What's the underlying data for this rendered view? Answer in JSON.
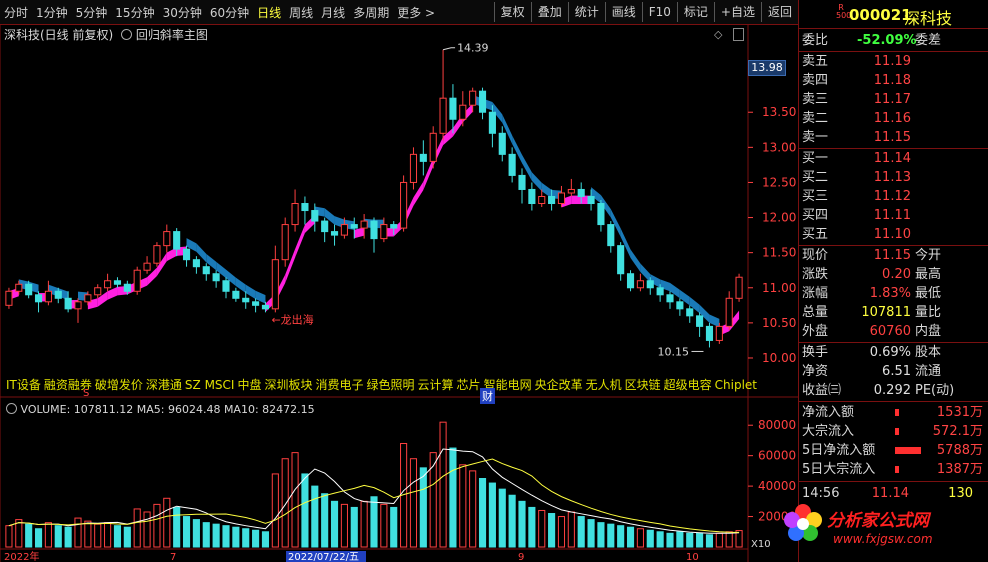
{
  "toolbar": {
    "timeframes": [
      "分时",
      "1分钟",
      "5分钟",
      "15分钟",
      "30分钟",
      "60分钟",
      "日线",
      "周线",
      "月线",
      "多周期",
      "更多 >"
    ],
    "active": "日线",
    "buttons": [
      "复权",
      "叠加",
      "统计",
      "画线",
      "F10",
      "标记",
      "+自选",
      "返回"
    ]
  },
  "chart": {
    "title": "深科技(日线 前复权)",
    "indicator_title": "回归斜率主图",
    "price_ticks": [
      "13.50",
      "13.00",
      "12.50",
      "12.00",
      "11.50",
      "11.00",
      "10.50",
      "10.00"
    ],
    "current_price_tag": "13.98",
    "high_label": "14.39",
    "low_label": "10.15",
    "annotation": "←龙出海",
    "concepts": [
      "IT设备",
      "融资融券",
      "破增发价",
      "深港通",
      "SZ MSCI",
      "中盘",
      "深圳板块",
      "消费电子",
      "绿色照明",
      "云计算",
      "芯片",
      "智能电网",
      "央企改革",
      "无人机",
      "区块链",
      "超级电容",
      "Chiplet"
    ],
    "marker_s": "S",
    "marker_cai": "财",
    "volume_header": "VOLUME: 107811.12  MA5: 96024.48  MA10: 82472.15",
    "volume_ticks": [
      "80000",
      "60000",
      "40000",
      "20000"
    ],
    "volume_unit": "X10",
    "date_labels": [
      "2022年",
      "7",
      "2022/07/22/五",
      "9",
      "10"
    ]
  },
  "chart_data": {
    "type": "candlestick",
    "ylim": [
      9.9,
      14.6
    ],
    "candles": [
      [
        10.75,
        10.95,
        10.7,
        11.0
      ],
      [
        10.95,
        11.05,
        10.9,
        11.1
      ],
      [
        11.05,
        10.9,
        10.85,
        11.1
      ],
      [
        10.9,
        10.8,
        10.65,
        10.95
      ],
      [
        10.8,
        10.95,
        10.75,
        11.1
      ],
      [
        10.95,
        10.85,
        10.78,
        11.0
      ],
      [
        10.85,
        10.7,
        10.65,
        10.95
      ],
      [
        10.7,
        10.8,
        10.5,
        10.85
      ],
      [
        10.8,
        10.9,
        10.75,
        10.95
      ],
      [
        10.9,
        11.0,
        10.85,
        11.05
      ],
      [
        11.0,
        11.1,
        10.95,
        11.2
      ],
      [
        11.1,
        11.05,
        11.0,
        11.15
      ],
      [
        11.05,
        10.95,
        10.9,
        11.1
      ],
      [
        10.95,
        11.25,
        10.9,
        11.3
      ],
      [
        11.25,
        11.35,
        11.2,
        11.45
      ],
      [
        11.35,
        11.6,
        11.3,
        11.65
      ],
      [
        11.6,
        11.8,
        11.5,
        11.9
      ],
      [
        11.8,
        11.55,
        11.45,
        11.85
      ],
      [
        11.55,
        11.4,
        11.3,
        11.6
      ],
      [
        11.4,
        11.3,
        11.2,
        11.45
      ],
      [
        11.3,
        11.2,
        11.1,
        11.35
      ],
      [
        11.2,
        11.1,
        11.0,
        11.25
      ],
      [
        11.1,
        10.95,
        10.85,
        11.15
      ],
      [
        10.95,
        10.85,
        10.8,
        11.0
      ],
      [
        10.85,
        10.8,
        10.7,
        10.95
      ],
      [
        10.8,
        10.75,
        10.65,
        10.85
      ],
      [
        10.75,
        10.7,
        10.65,
        10.8
      ],
      [
        10.7,
        11.4,
        10.65,
        11.6
      ],
      [
        11.4,
        11.9,
        11.3,
        12.0
      ],
      [
        11.9,
        12.2,
        11.8,
        12.4
      ],
      [
        12.2,
        12.1,
        11.9,
        12.3
      ],
      [
        12.1,
        11.95,
        11.8,
        12.2
      ],
      [
        11.95,
        11.8,
        11.65,
        12.0
      ],
      [
        11.8,
        11.75,
        11.6,
        11.9
      ],
      [
        11.75,
        11.9,
        11.7,
        12.0
      ],
      [
        11.9,
        11.85,
        11.7,
        12.0
      ],
      [
        11.85,
        11.95,
        11.7,
        12.05
      ],
      [
        11.95,
        11.7,
        11.5,
        12.0
      ],
      [
        11.7,
        11.9,
        11.65,
        12.0
      ],
      [
        11.9,
        11.85,
        11.75,
        11.95
      ],
      [
        11.85,
        12.5,
        11.8,
        12.6
      ],
      [
        12.5,
        12.9,
        12.4,
        13.0
      ],
      [
        12.9,
        12.8,
        12.6,
        13.1
      ],
      [
        12.8,
        13.2,
        12.7,
        13.3
      ],
      [
        13.2,
        13.7,
        13.1,
        14.39
      ],
      [
        13.7,
        13.4,
        13.2,
        13.9
      ],
      [
        13.4,
        13.6,
        13.3,
        13.8
      ],
      [
        13.6,
        13.8,
        13.5,
        13.85
      ],
      [
        13.8,
        13.5,
        13.4,
        13.85
      ],
      [
        13.5,
        13.2,
        13.0,
        13.6
      ],
      [
        13.2,
        12.9,
        12.8,
        13.3
      ],
      [
        12.9,
        12.6,
        12.5,
        13.0
      ],
      [
        12.6,
        12.4,
        12.2,
        12.7
      ],
      [
        12.4,
        12.2,
        12.1,
        12.5
      ],
      [
        12.2,
        12.3,
        12.15,
        12.4
      ],
      [
        12.3,
        12.2,
        12.1,
        12.4
      ],
      [
        12.2,
        12.35,
        12.15,
        12.45
      ],
      [
        12.35,
        12.4,
        12.3,
        12.55
      ],
      [
        12.4,
        12.3,
        12.2,
        12.5
      ],
      [
        12.3,
        12.2,
        12.1,
        12.4
      ],
      [
        12.2,
        11.9,
        11.8,
        12.25
      ],
      [
        11.9,
        11.6,
        11.5,
        11.95
      ],
      [
        11.6,
        11.2,
        11.1,
        11.65
      ],
      [
        11.2,
        11.0,
        10.95,
        11.25
      ],
      [
        11.0,
        11.1,
        10.95,
        11.2
      ],
      [
        11.1,
        11.0,
        10.9,
        11.15
      ],
      [
        11.0,
        10.9,
        10.8,
        11.05
      ],
      [
        10.9,
        10.8,
        10.7,
        10.95
      ],
      [
        10.8,
        10.7,
        10.6,
        10.85
      ],
      [
        10.7,
        10.6,
        10.5,
        10.75
      ],
      [
        10.6,
        10.45,
        10.3,
        10.65
      ],
      [
        10.45,
        10.25,
        10.15,
        10.5
      ],
      [
        10.25,
        10.45,
        10.2,
        10.5
      ],
      [
        10.45,
        10.85,
        10.4,
        10.95
      ],
      [
        10.85,
        11.15,
        10.8,
        11.2
      ]
    ],
    "volume_x10": [
      1400,
      1800,
      1500,
      1200,
      1600,
      1400,
      1300,
      1900,
      1700,
      1500,
      1600,
      1400,
      1300,
      2500,
      2300,
      2800,
      3200,
      2600,
      2000,
      1800,
      1600,
      1500,
      1400,
      1300,
      1200,
      1100,
      1000,
      4800,
      5800,
      6200,
      4800,
      4000,
      3500,
      3000,
      2800,
      2600,
      3000,
      3300,
      2800,
      2600,
      6800,
      5800,
      5200,
      6200,
      8200,
      6500,
      5400,
      5000,
      4500,
      4200,
      3800,
      3400,
      3000,
      2600,
      2400,
      2200,
      2000,
      2300,
      2000,
      1800,
      1600,
      1500,
      1400,
      1300,
      1200,
      1100,
      1000,
      900,
      1000,
      900,
      900,
      800,
      900,
      1000,
      1080
    ]
  },
  "quote": {
    "code": "000021",
    "name": "深科技",
    "badge_top": "R",
    "badge_bottom": "500",
    "weibi_label": "委比",
    "weibi_value": "-52.09%",
    "weicha_label": "委差",
    "sells": [
      [
        "卖五",
        "11.19"
      ],
      [
        "卖四",
        "11.18"
      ],
      [
        "卖三",
        "11.17"
      ],
      [
        "卖二",
        "11.16"
      ],
      [
        "卖一",
        "11.15"
      ]
    ],
    "buys": [
      [
        "买一",
        "11.14"
      ],
      [
        "买二",
        "11.13"
      ],
      [
        "买三",
        "11.12"
      ],
      [
        "买四",
        "11.11"
      ],
      [
        "买五",
        "11.10"
      ]
    ],
    "stats": [
      [
        "现价",
        "11.15",
        "今开"
      ],
      [
        "涨跌",
        "0.20",
        "最高"
      ],
      [
        "涨幅",
        "1.83%",
        "最低"
      ],
      [
        "总量",
        "107811",
        "量比"
      ],
      [
        "外盘",
        "60760",
        "内盘"
      ]
    ],
    "stats2": [
      [
        "换手",
        "0.69%",
        "股本"
      ],
      [
        "净资",
        "6.51",
        "流通"
      ],
      [
        "收益㈢",
        "0.292",
        "PE(动)"
      ]
    ],
    "flows": [
      [
        "净流入额",
        "1531万"
      ],
      [
        "大宗流入",
        "572.1万"
      ],
      [
        "5日净流入额",
        "5788万"
      ],
      [
        "5日大宗流入",
        "1387万"
      ]
    ],
    "tick_time": "14:56",
    "tick_price": "11.14",
    "tick_vol": "130"
  },
  "watermark": {
    "text": "分析家公式网",
    "url": "www.fxjgsw.com"
  }
}
